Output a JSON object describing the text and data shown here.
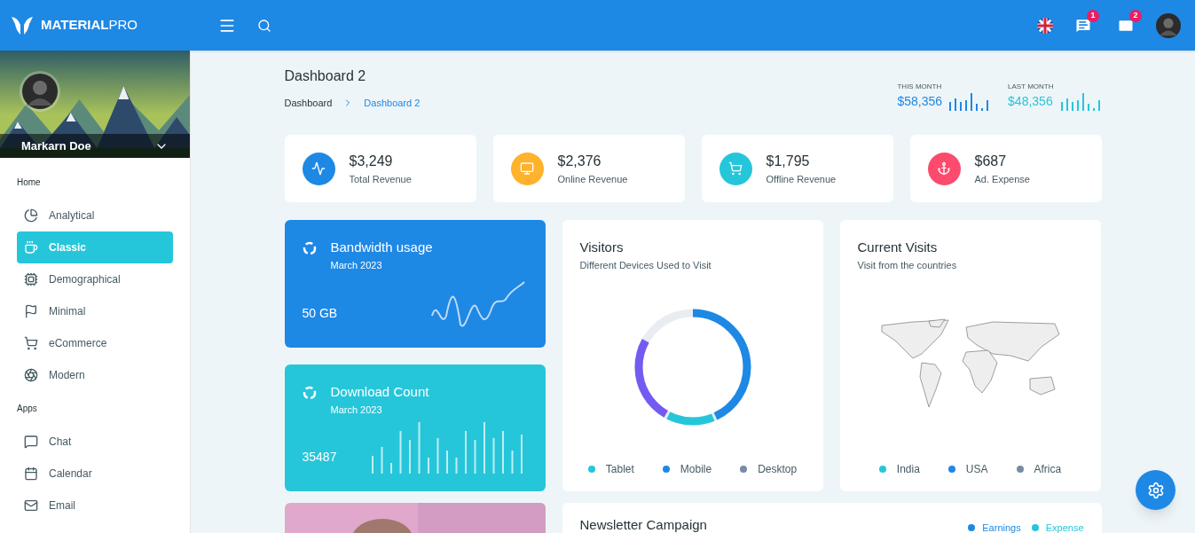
{
  "topbar": {
    "logo": "MATERIAL",
    "logo_suffix": "PRO",
    "notifications": [
      {
        "kind": "chat",
        "count": "1"
      },
      {
        "kind": "mail",
        "count": "2"
      }
    ]
  },
  "sidebar": {
    "user": "Markarn Doe",
    "sections": [
      {
        "title": "Home",
        "items": [
          {
            "label": "Analytical",
            "selected": false
          },
          {
            "label": "Classic",
            "selected": true
          },
          {
            "label": "Demographical",
            "selected": false
          },
          {
            "label": "Minimal",
            "selected": false
          },
          {
            "label": "eCommerce",
            "selected": false
          },
          {
            "label": "Modern",
            "selected": false
          }
        ]
      },
      {
        "title": "Apps",
        "items": [
          {
            "label": "Chat",
            "selected": false
          },
          {
            "label": "Calendar",
            "selected": false
          },
          {
            "label": "Email",
            "selected": false
          }
        ]
      }
    ]
  },
  "page": {
    "title": "Dashboard 2",
    "breadcrumb": [
      {
        "label": "Dashboard",
        "selected": false
      },
      {
        "label": "Dashboard 2",
        "selected": true
      }
    ]
  },
  "month_stats": [
    {
      "label": "THIS MONTH",
      "value": "$58,356",
      "color": "#1e88e5"
    },
    {
      "label": "LAST MONTH",
      "value": "$48,356",
      "color": "#26c6da"
    }
  ],
  "stat_cards": [
    {
      "value": "$3,249",
      "label": "Total Revenue",
      "color": "#1e88e5"
    },
    {
      "value": "$2,376",
      "label": "Online Revenue",
      "color": "#ffb22b"
    },
    {
      "value": "$1,795",
      "label": "Offline Revenue",
      "color": "#26c6da"
    },
    {
      "value": "$687",
      "label": "Ad. Expense",
      "color": "#fc4b6c"
    }
  ],
  "bandwidth": {
    "title": "Bandwidth usage",
    "subtitle": "March 2023",
    "value": "50 GB"
  },
  "download": {
    "title": "Download Count",
    "subtitle": "March 2023",
    "value": "35487"
  },
  "visitors": {
    "title": "Visitors",
    "subtitle": "Different Devices Used to Visit",
    "legend": [
      {
        "label": "Tablet",
        "color": "#26c6da"
      },
      {
        "label": "Mobile",
        "color": "#1e88e5"
      },
      {
        "label": "Desktop",
        "color": "#7a8ba6"
      }
    ]
  },
  "current_visits": {
    "title": "Current Visits",
    "subtitle": "Visit from the countries",
    "legend": [
      {
        "label": "India",
        "color": "#26c6da"
      },
      {
        "label": "USA",
        "color": "#1e88e5"
      },
      {
        "label": "Africa",
        "color": "#7a8ba6"
      }
    ]
  },
  "newsletter": {
    "title": "Newsletter Campaign",
    "legend": [
      {
        "label": "Earnings",
        "color": "#1e88e5"
      },
      {
        "label": "Expense",
        "color": "#26c6da"
      }
    ]
  }
}
